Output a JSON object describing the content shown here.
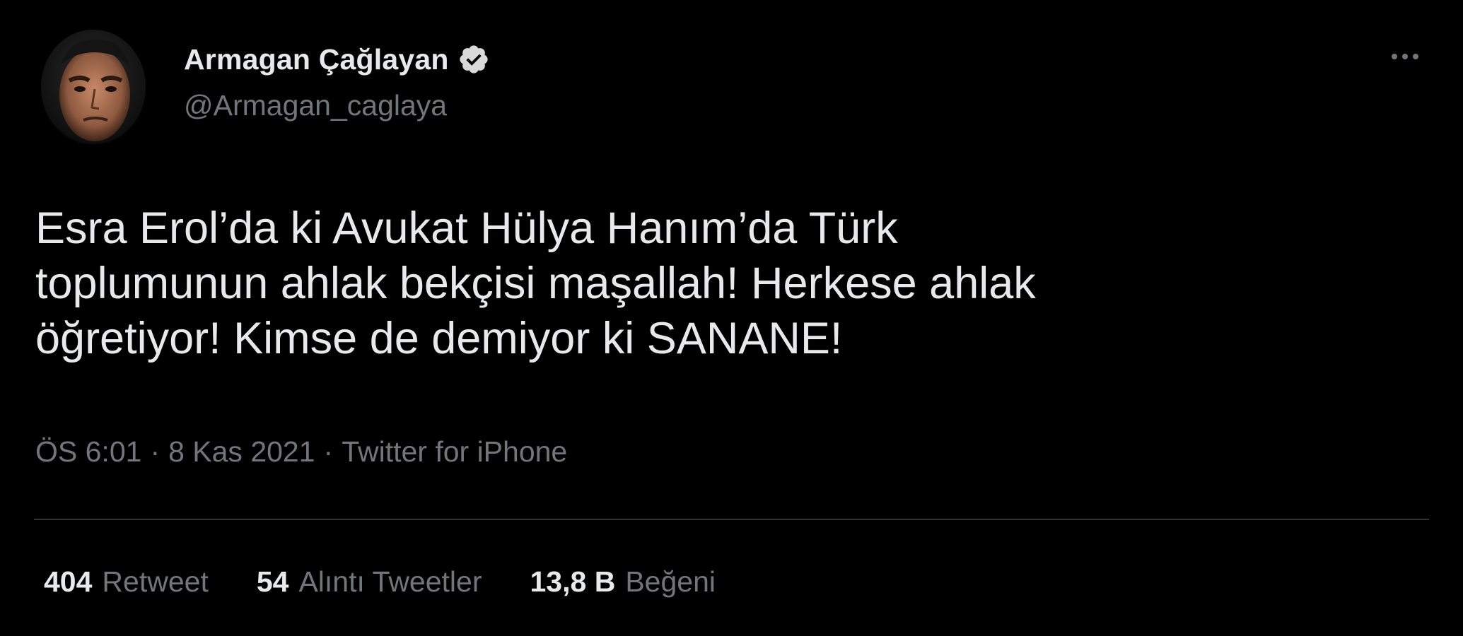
{
  "author": {
    "display_name": "Armagan Çağlayan",
    "handle": "@Armagan_caglaya",
    "verified": true,
    "avatar_icon": "profile-photo"
  },
  "menu": {
    "icon": "more-horizontal-icon"
  },
  "tweet": {
    "text_lines": [
      "Esra Erol’da ki Avukat Hülya Hanım’da Türk",
      "toplumunun ahlak bekçisi maşallah! Herkese ahlak",
      "öğretiyor! Kimse de demiyor ki SANANE!"
    ],
    "time": "ÖS 6:01",
    "date": "8 Kas 2021",
    "source": "Twitter for iPhone",
    "separator": "·"
  },
  "stats": [
    {
      "count": "404",
      "label": "Retweet"
    },
    {
      "count": "54",
      "label": "Alıntı Tweetler"
    },
    {
      "count": "13,8 B",
      "label": "Beğeni"
    }
  ],
  "colors": {
    "background": "#000000",
    "primary_text": "#e7e9ea",
    "secondary_text": "#71767b",
    "divider": "#2f3336",
    "verified_badge": "#d9d9d9"
  }
}
